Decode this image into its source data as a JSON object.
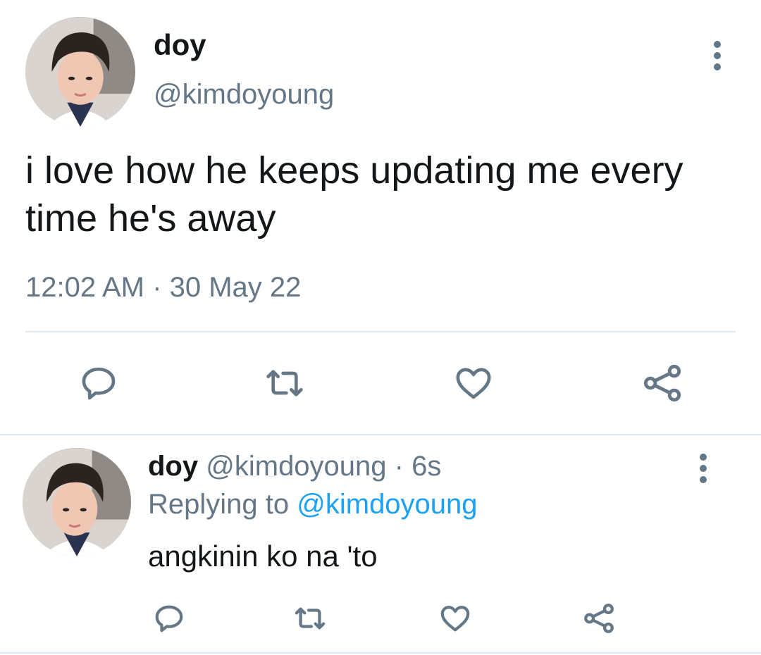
{
  "tweet": {
    "display_name": "doy",
    "handle": "@kimdoyoung",
    "text": "i love how he keeps updating me every time he's away",
    "time": "12:02 AM",
    "separator": "·",
    "date": "30 May 22",
    "actions": [
      "reply-icon",
      "retweet-icon",
      "like-icon",
      "share-icon"
    ]
  },
  "reply": {
    "display_name": "doy",
    "handle": "@kimdoyoung",
    "separator": "·",
    "age": "6s",
    "replying_prefix": "Replying to",
    "replying_to": "@kimdoyoung",
    "text": "angkinin ko na 'to",
    "actions": [
      "reply-icon",
      "retweet-icon",
      "like-icon",
      "share-icon"
    ]
  },
  "colors": {
    "text_primary": "#14171a",
    "text_secondary": "#657786",
    "mention": "#1da1f2",
    "divider": "#e1e8ed"
  }
}
